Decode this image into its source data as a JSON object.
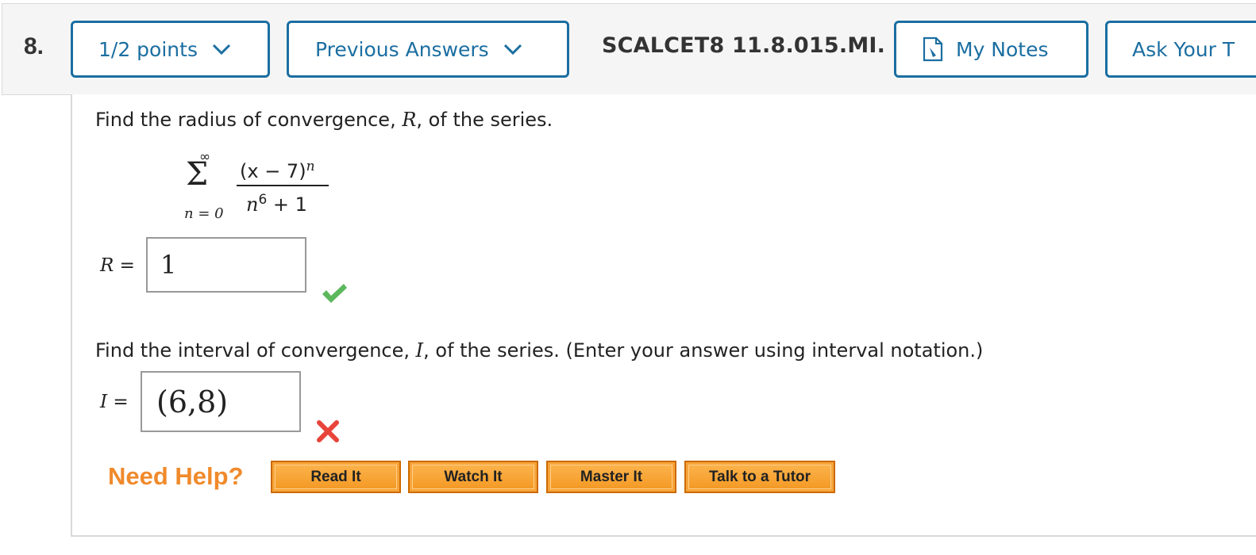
{
  "header": {
    "question_number": "8.",
    "points_label": "1/2 points",
    "previous_answers_label": "Previous Answers",
    "problem_id": "SCALCET8 11.8.015.MI.",
    "my_notes_label": "My Notes",
    "ask_label": "Ask Your T"
  },
  "question": {
    "part1_prefix": "Find the radius of convergence, ",
    "part1_var": "R",
    "part1_suffix": ", of the series.",
    "series": {
      "upper": "∞",
      "sigma": "Σ",
      "lower": "n = 0",
      "numerator_base": "(x − 7)",
      "numerator_exp": "n",
      "denominator_base": "n",
      "denominator_exp": "6",
      "denominator_rest": " + 1"
    },
    "part2_prefix": "Find the interval of convergence, ",
    "part2_var": "I",
    "part2_suffix": ", of the series. (Enter your answer using interval notation.)"
  },
  "answers": {
    "r_label": "R =",
    "r_value": "1",
    "r_status": "correct",
    "i_label": "I =",
    "i_value": "(6,8)",
    "i_status": "incorrect"
  },
  "help": {
    "title": "Need Help?",
    "read_it": "Read It",
    "watch_it": "Watch It",
    "master_it": "Master It",
    "talk_to_tutor": "Talk to a Tutor"
  },
  "icons": {
    "points_chevron": "chevron-down-icon",
    "answers_chevron": "chevron-down-icon",
    "notes": "note-icon",
    "correct": "checkmark-icon",
    "incorrect": "x-mark-icon"
  },
  "colors": {
    "primary_blue": "#1b6ea1",
    "help_orange": "#f08a2c",
    "button_orange": "#f7a43a",
    "correct_green": "#5cb85c",
    "incorrect_red": "#e8443a"
  }
}
